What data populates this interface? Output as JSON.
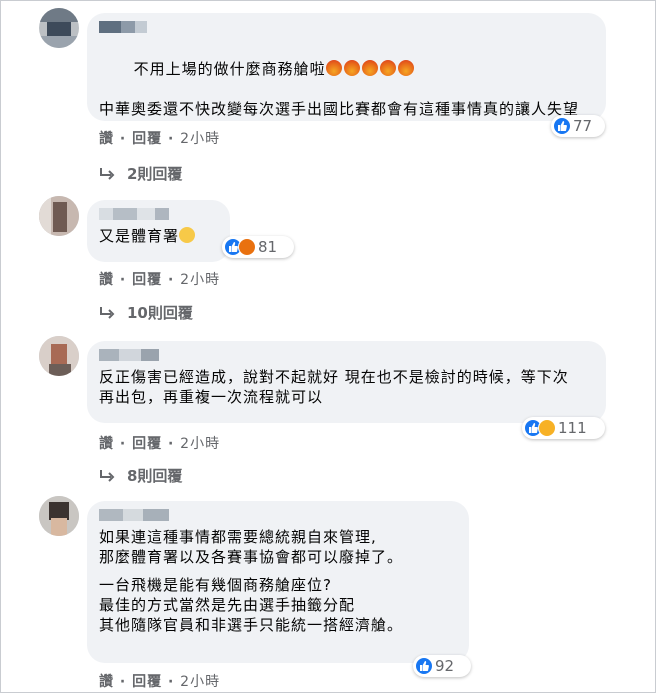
{
  "comments": [
    {
      "text": "不用上場的做什麼商務艙啦",
      "text2": "中華奧委還不快改變每次選手出國比賽都會有這種事情真的讓人失望",
      "reaction_count": "77",
      "like": "讚",
      "reply": "回覆",
      "time": "2小時",
      "replies": "2則回覆"
    },
    {
      "text": "又是體育署",
      "reaction_count": "81",
      "like": "讚",
      "reply": "回覆",
      "time": "2小時",
      "replies": "10則回覆"
    },
    {
      "text": "反正傷害已經造成，說對不起就好 現在也不是檢討的時候，等下次再出包，再重複一次流程就可以",
      "reaction_count": "111",
      "like": "讚",
      "reply": "回覆",
      "time": "2小時",
      "replies": "8則回覆"
    },
    {
      "text": "如果連這種事情都需要總統親自來管理,\n那麼體育署以及各賽事協會都可以廢掉了。",
      "text2": "一台飛機是能有幾個商務艙座位?\n最佳的方式當然是先由選手抽籤分配\n其他隨隊官員和非選手只能統一搭經濟艙。",
      "reaction_count": "92",
      "like": "讚",
      "reply": "回覆",
      "time": "2小時"
    }
  ],
  "colors": {
    "like": "#1877f2",
    "angry": "#e9710f",
    "haha": "#f7b125",
    "bubble": "#f0f2f5",
    "meta": "#65676b"
  }
}
